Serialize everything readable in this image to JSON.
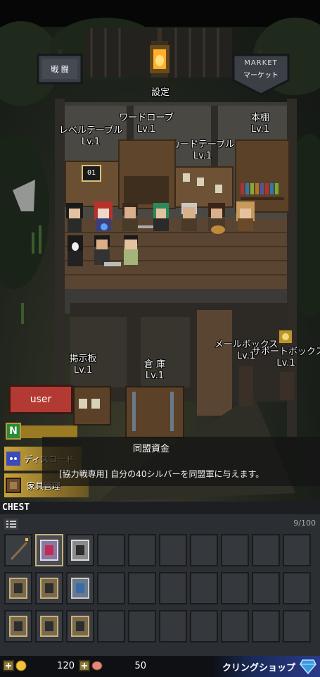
{
  "top_signs": {
    "battle": "戦 闘",
    "market_en": "MARKET",
    "market_jp": "マーケット",
    "settings": "設定"
  },
  "furniture": {
    "level_table": {
      "name": "レベルテーブル",
      "level": "Lv.1",
      "counter": "01"
    },
    "wardrobe": {
      "name": "ワードローブ",
      "level": "Lv.1"
    },
    "card_table": {
      "name": "カードテーブル",
      "level": "Lv.1"
    },
    "bookshelf": {
      "name": "本棚",
      "level": "Lv.1"
    },
    "bulletin_board": {
      "name": "掲示板",
      "level": "Lv.1"
    },
    "warehouse": {
      "name": "倉 庫",
      "level": "Lv.1"
    },
    "mailbox": {
      "name": "メールボックス",
      "level": "Lv.1"
    },
    "support_box": {
      "name": "サポートボックス",
      "level": "Lv.1"
    }
  },
  "side_menu": {
    "user": "user",
    "n_badge": "N",
    "discord": "ディスコード",
    "furniture_mgmt": "家具管理"
  },
  "tooltip": {
    "title": "同盟資金",
    "description": "[協力戦専用] 自分の40シルバーを同盟軍に与えます。"
  },
  "chest": {
    "title": "CHEST",
    "capacity": "9/100"
  },
  "bottom_bar": {
    "gold": "120",
    "meat": "50",
    "shop": "クリングショップ"
  },
  "colors": {
    "user_button": "#b23a32",
    "n_badge": "#2a8c3a",
    "discord_icon": "#3b4bb8",
    "gold": "#f2c23a"
  }
}
